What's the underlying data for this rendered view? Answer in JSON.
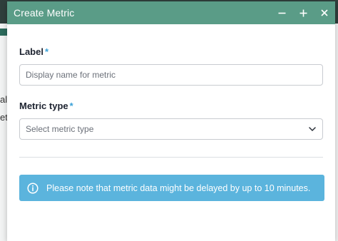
{
  "dialog": {
    "title": "Create Metric",
    "controls": {
      "minimize_icon": "minus-icon",
      "maximize_icon": "plus-icon",
      "close_icon": "close-icon"
    }
  },
  "form": {
    "label": {
      "text": "Label",
      "required_mark": "*",
      "placeholder": "Display name for metric",
      "value": ""
    },
    "metric_type": {
      "text": "Metric type",
      "required_mark": "*",
      "placeholder": "Select metric type",
      "selected": ""
    }
  },
  "notice": {
    "icon": "info-icon",
    "text": "Please note that metric data might be delayed by up to 10 minutes."
  },
  "background": {
    "fragment_1": "all",
    "fragment_2": "etr"
  },
  "colors": {
    "titlebar": "#5a9c87",
    "required": "#3aa1d8",
    "notice_bg": "#5bb4dd",
    "background_bar": "#2f3f3c"
  }
}
